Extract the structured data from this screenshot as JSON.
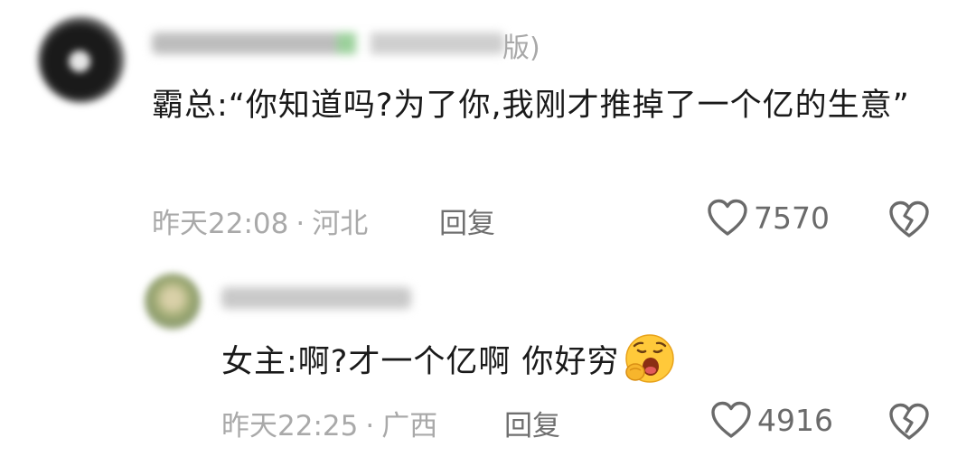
{
  "comments": [
    {
      "name_suffix": "版)",
      "text": "霸总:“你知道吗?为了你,我刚才推掉了一个亿的生意”",
      "time": "昨天22:08",
      "region": "河北",
      "reply_label": "回复",
      "likes": "7570",
      "icons": {
        "like": "heart-outline-icon",
        "dislike": "broken-heart-icon"
      }
    },
    {
      "text": "女主:啊?才一个亿啊 你好穷",
      "emoji": "yawning-face-emoji",
      "time": "昨天22:25",
      "region": "广西",
      "reply_label": "回复",
      "likes": "4916",
      "icons": {
        "like": "heart-outline-icon",
        "dislike": "broken-heart-icon"
      }
    }
  ]
}
